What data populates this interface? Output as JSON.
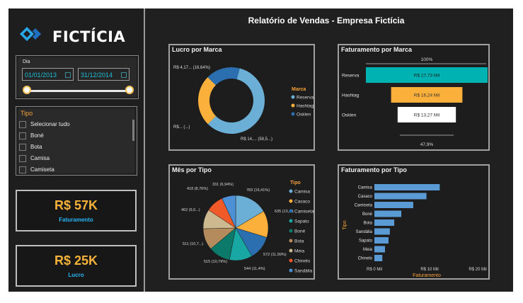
{
  "logo": {
    "text": "FICTÍCIA"
  },
  "report_title": "Relatório de Vendas - Empresa Fictícia",
  "date_filter": {
    "label": "Dia",
    "start": "01/01/2013",
    "end": "31/12/2014"
  },
  "tipo_filter": {
    "title": "Tipo",
    "items": [
      "Selecionar tudo",
      "Boné",
      "Bota",
      "Camisa",
      "Camiseta"
    ]
  },
  "kpis": {
    "faturamento": {
      "value": "R$ 57K",
      "label": "Faturamento"
    },
    "lucro": {
      "value": "R$ 25K",
      "label": "Lucro"
    }
  },
  "colors": {
    "accent": "#f7a13a",
    "label_blue": "#29b6f6",
    "teal": "#00b3b3"
  },
  "chart_data": [
    {
      "type": "pie",
      "title": "Lucro por Marca",
      "legend_title": "Marca",
      "legend_position": "right",
      "categories": [
        "Reserva",
        "Hashtag",
        "Osklen"
      ],
      "values": [
        58.5,
        24.86,
        16.64
      ],
      "data_labels": [
        "R$ 14,... (58,5...)",
        "R$... (...)",
        "R$ 4,17... (16,64%)"
      ],
      "colors": [
        "#6baed6",
        "#fbb03b",
        "#2c6fb0"
      ]
    },
    {
      "type": "bar",
      "title": "Faturamento por Marca",
      "categories": [
        "Reserva",
        "Hashtag",
        "Osklen"
      ],
      "values": [
        27.73,
        16.24,
        13.27
      ],
      "data_labels": [
        "R$ 27,73 Mil",
        "R$ 16,24 Mil",
        "R$ 13,27 Mil"
      ],
      "top_label": "100%",
      "bottom_label": "47,9%",
      "colors": [
        "#00b3b3",
        "#fbb03b",
        "#ffffff"
      ]
    },
    {
      "type": "pie",
      "title": "Mês por Tipo",
      "legend_title": "Tipo",
      "legend_position": "right",
      "categories": [
        "Camisa",
        "Casaco",
        "Camiseta",
        "Sapato",
        "Boné",
        "Bota",
        "Meia",
        "Chinelo",
        "Sandália"
      ],
      "values": [
        783,
        635,
        572,
        544,
        515,
        511,
        462,
        418,
        331
      ],
      "data_labels": [
        "783 (16,41%)",
        "635 (13,...)",
        "572 (11,99%)",
        "544 (11,4%)",
        "515 (10,79%)",
        "511 (10,7...)",
        "462 (9,6...)",
        "418 (8,76%)",
        "331 (6,94%)"
      ],
      "colors": [
        "#6baed6",
        "#fbb03b",
        "#2c6fb0",
        "#19a7a3",
        "#0b7a6a",
        "#b38b5d",
        "#cdb98f",
        "#f05a28",
        "#4d90d6"
      ]
    },
    {
      "type": "bar",
      "orientation": "horizontal",
      "title": "Faturamento por Tipo",
      "xlabel": "Faturamento",
      "ylabel": "Tipo",
      "categories": [
        "Camisa",
        "Casaco",
        "Camiseta",
        "Boné",
        "Bota",
        "Sandália",
        "Sapato",
        "Meia",
        "Chinelo"
      ],
      "values": [
        14.8,
        11.8,
        8.8,
        6.1,
        4.5,
        3.5,
        3.2,
        2.4,
        1.8
      ],
      "x_ticks": [
        "R$ 0 Mil",
        "R$ 10 Mil",
        "R$ 20 Mil"
      ],
      "xlim": [
        0,
        20
      ],
      "colors": [
        "#5b9bd5"
      ]
    }
  ]
}
